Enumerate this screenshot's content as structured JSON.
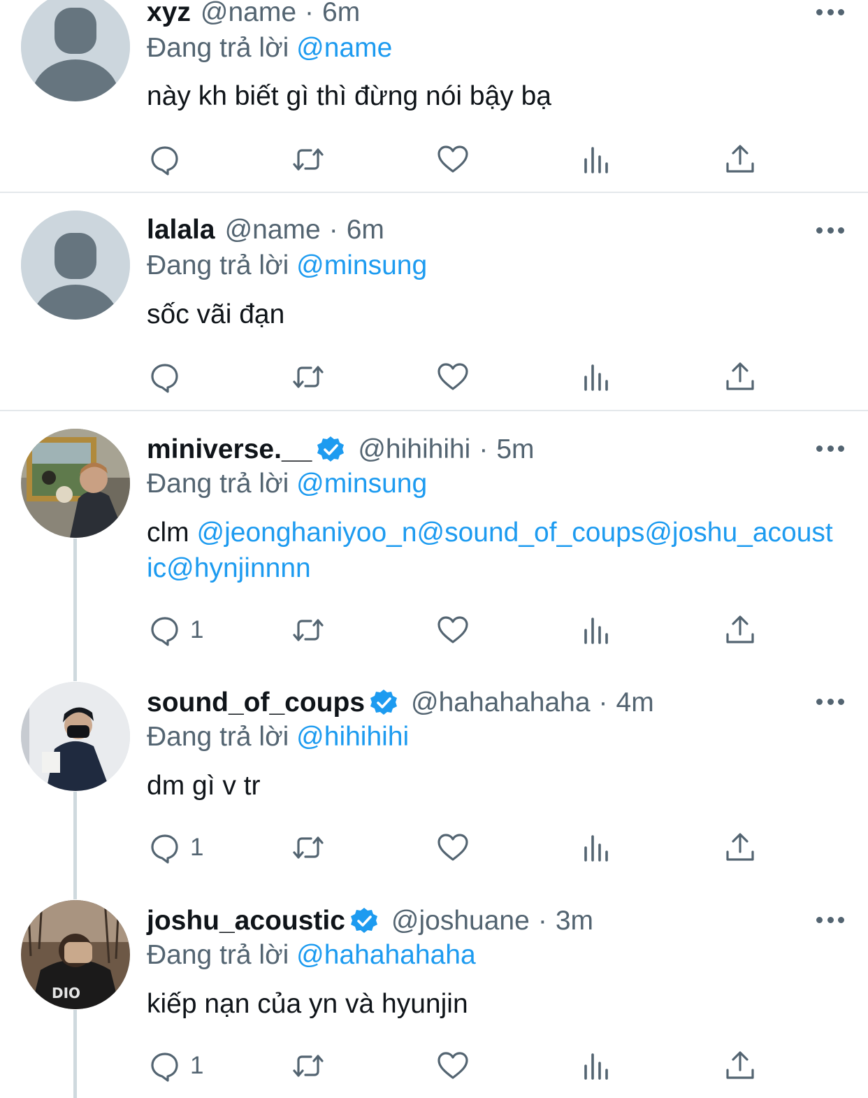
{
  "replying_label": "Đang trả lời",
  "icons": {
    "reply": "reply-icon",
    "retweet": "retweet-icon",
    "like": "heart-icon",
    "views": "views-icon",
    "share": "share-icon",
    "more": "more-icon",
    "verified": "verified-badge-icon"
  },
  "colors": {
    "mention": "#1d9bf0",
    "secondary_text": "#536471",
    "verified": "#1d9bf0"
  },
  "tweets": [
    {
      "display_name": "xyz",
      "handle": "@name",
      "time": "6m",
      "verified": false,
      "replying_to": "@name",
      "text_plain": "này kh biết gì thì đừng nói bậy bạ",
      "reply_count": ""
    },
    {
      "display_name": "lalala",
      "handle": "@name",
      "time": "6m",
      "verified": false,
      "replying_to": "@minsung",
      "text_plain": "sốc vãi đạn",
      "reply_count": ""
    },
    {
      "display_name": "miniverse.__",
      "handle": "@hihihihi",
      "time": "5m",
      "verified": true,
      "replying_to": "@minsung",
      "text_prefix": "clm ",
      "text_mentions": "@jeonghaniyoo_n@sound_of_coups@joshu_acoustic@hynjinnnn",
      "reply_count": "1"
    },
    {
      "display_name": "sound_of_coups",
      "handle": "@hahahahaha",
      "time": "4m",
      "verified": true,
      "replying_to": "@hihihihi",
      "text_plain": "dm gì v tr",
      "reply_count": "1"
    },
    {
      "display_name": "joshu_acoustic",
      "handle": "@joshuane",
      "time": "3m",
      "verified": true,
      "replying_to": "@hahahahaha",
      "text_plain": "kiếp nạn của yn và hyunjin",
      "reply_count": "1"
    }
  ]
}
